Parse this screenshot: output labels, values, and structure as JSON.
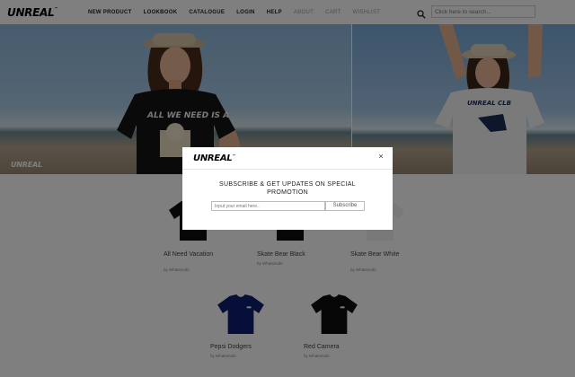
{
  "header": {
    "logo": "UNREAL",
    "nav": [
      {
        "label": "NEW PRODUCT",
        "style": "bold"
      },
      {
        "label": "LOOKBOOK",
        "style": "bold"
      },
      {
        "label": "CATALOGUE",
        "style": "bold"
      },
      {
        "label": "LOGIN",
        "style": "bold"
      },
      {
        "label": "HELP",
        "style": "bold"
      },
      {
        "label": "ABOUT",
        "style": "light"
      },
      {
        "label": "CART",
        "style": "light"
      },
      {
        "label": "WISHLIST",
        "style": "light"
      }
    ],
    "search_placeholder": "Click here to search...",
    "search_icon": "search-icon"
  },
  "hero": {
    "logo": "UNREAL",
    "left_shirt_text": "ALL WE NEED IS A",
    "right_shirt_text": "UNREAL CLB"
  },
  "products": [
    {
      "name": "All Need Vacation",
      "by": "by Whatsmobi"
    },
    {
      "name": "Skate Bear Black",
      "by": "by Whatsmobi"
    },
    {
      "name": "Skate Bear White",
      "by": "by Whatsmobi"
    },
    {
      "name": "Pepsi Dodgers",
      "by": "by Whatsmobi",
      "color": "#0a1f6e"
    },
    {
      "name": "Red Camera",
      "by": "by Whatsmobi",
      "color": "#0d0d0d"
    }
  ],
  "modal": {
    "logo": "UNREAL",
    "close_label": "×",
    "heading": "SUBSCRIBE & GET UPDATES ON SPECIAL PROMOTION",
    "email_placeholder": "Input your email here..",
    "subscribe_label": "Subscribe"
  }
}
